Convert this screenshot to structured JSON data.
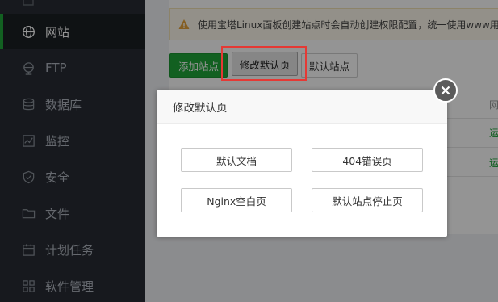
{
  "sidebar": {
    "items": [
      {
        "label": "网站",
        "icon": "globe-icon"
      },
      {
        "label": "FTP",
        "icon": "ftp-icon"
      },
      {
        "label": "数据库",
        "icon": "database-icon"
      },
      {
        "label": "监控",
        "icon": "monitor-icon"
      },
      {
        "label": "安全",
        "icon": "shield-icon"
      },
      {
        "label": "文件",
        "icon": "folder-icon"
      },
      {
        "label": "计划任务",
        "icon": "calendar-icon"
      },
      {
        "label": "软件管理",
        "icon": "grid-icon"
      }
    ],
    "active_index": 0,
    "accent": "#20a53a"
  },
  "main": {
    "alert_text": "使用宝塔Linux面板创建站点时会自动创建权限配置，统一使用www用",
    "toolbar": {
      "add_site_label": "添加站点",
      "modify_default_page_label": "修改默认页",
      "default_site_label": "默认站点"
    },
    "table": {
      "header_fragment": "网",
      "status_fragments": [
        "运",
        "运"
      ]
    }
  },
  "modal": {
    "title": "修改默认页",
    "buttons": {
      "default_document": "默认文档",
      "error_404": "404错误页",
      "nginx_blank": "Nginx空白页",
      "default_site_stopped": "默认站点停止页"
    }
  }
}
